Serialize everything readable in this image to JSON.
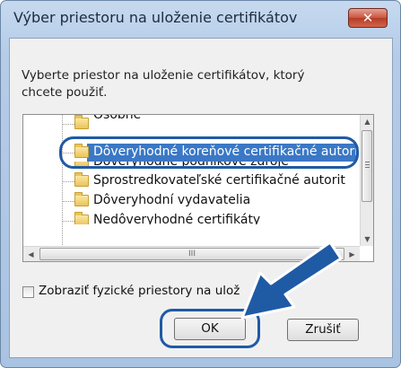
{
  "window": {
    "title": "Výber priestoru na uloženie certifikátov",
    "close_glyph": "✕"
  },
  "prompt_text": "Vyberte priestor na uloženie certifikátov, ktorý chcete použiť.",
  "tree": {
    "items": [
      {
        "label": "Osobné"
      },
      {
        "label": "Dôveryhodné koreňové certifikačné autorit",
        "selected": true
      },
      {
        "label": "Dôveryhodné podnikové zdroje"
      },
      {
        "label": "Sprostredkovateľské certifikačné autorit"
      },
      {
        "label": "Dôveryhodní vydavatelia"
      },
      {
        "label": "Nedôveryhodné certifikáty"
      }
    ],
    "scroll_up": "▲",
    "scroll_down": "▼",
    "scroll_left": "◀",
    "scroll_right": "▶",
    "hthumb_grip": "III"
  },
  "checkbox": {
    "label": "Zobraziť fyzické priestory na ulož",
    "checked": false
  },
  "buttons": {
    "ok": "OK",
    "cancel": "Zrušiť"
  },
  "colors": {
    "highlight": "#1f5aa5",
    "selection": "#3a78c6",
    "arrow": "#1f5aa5"
  }
}
